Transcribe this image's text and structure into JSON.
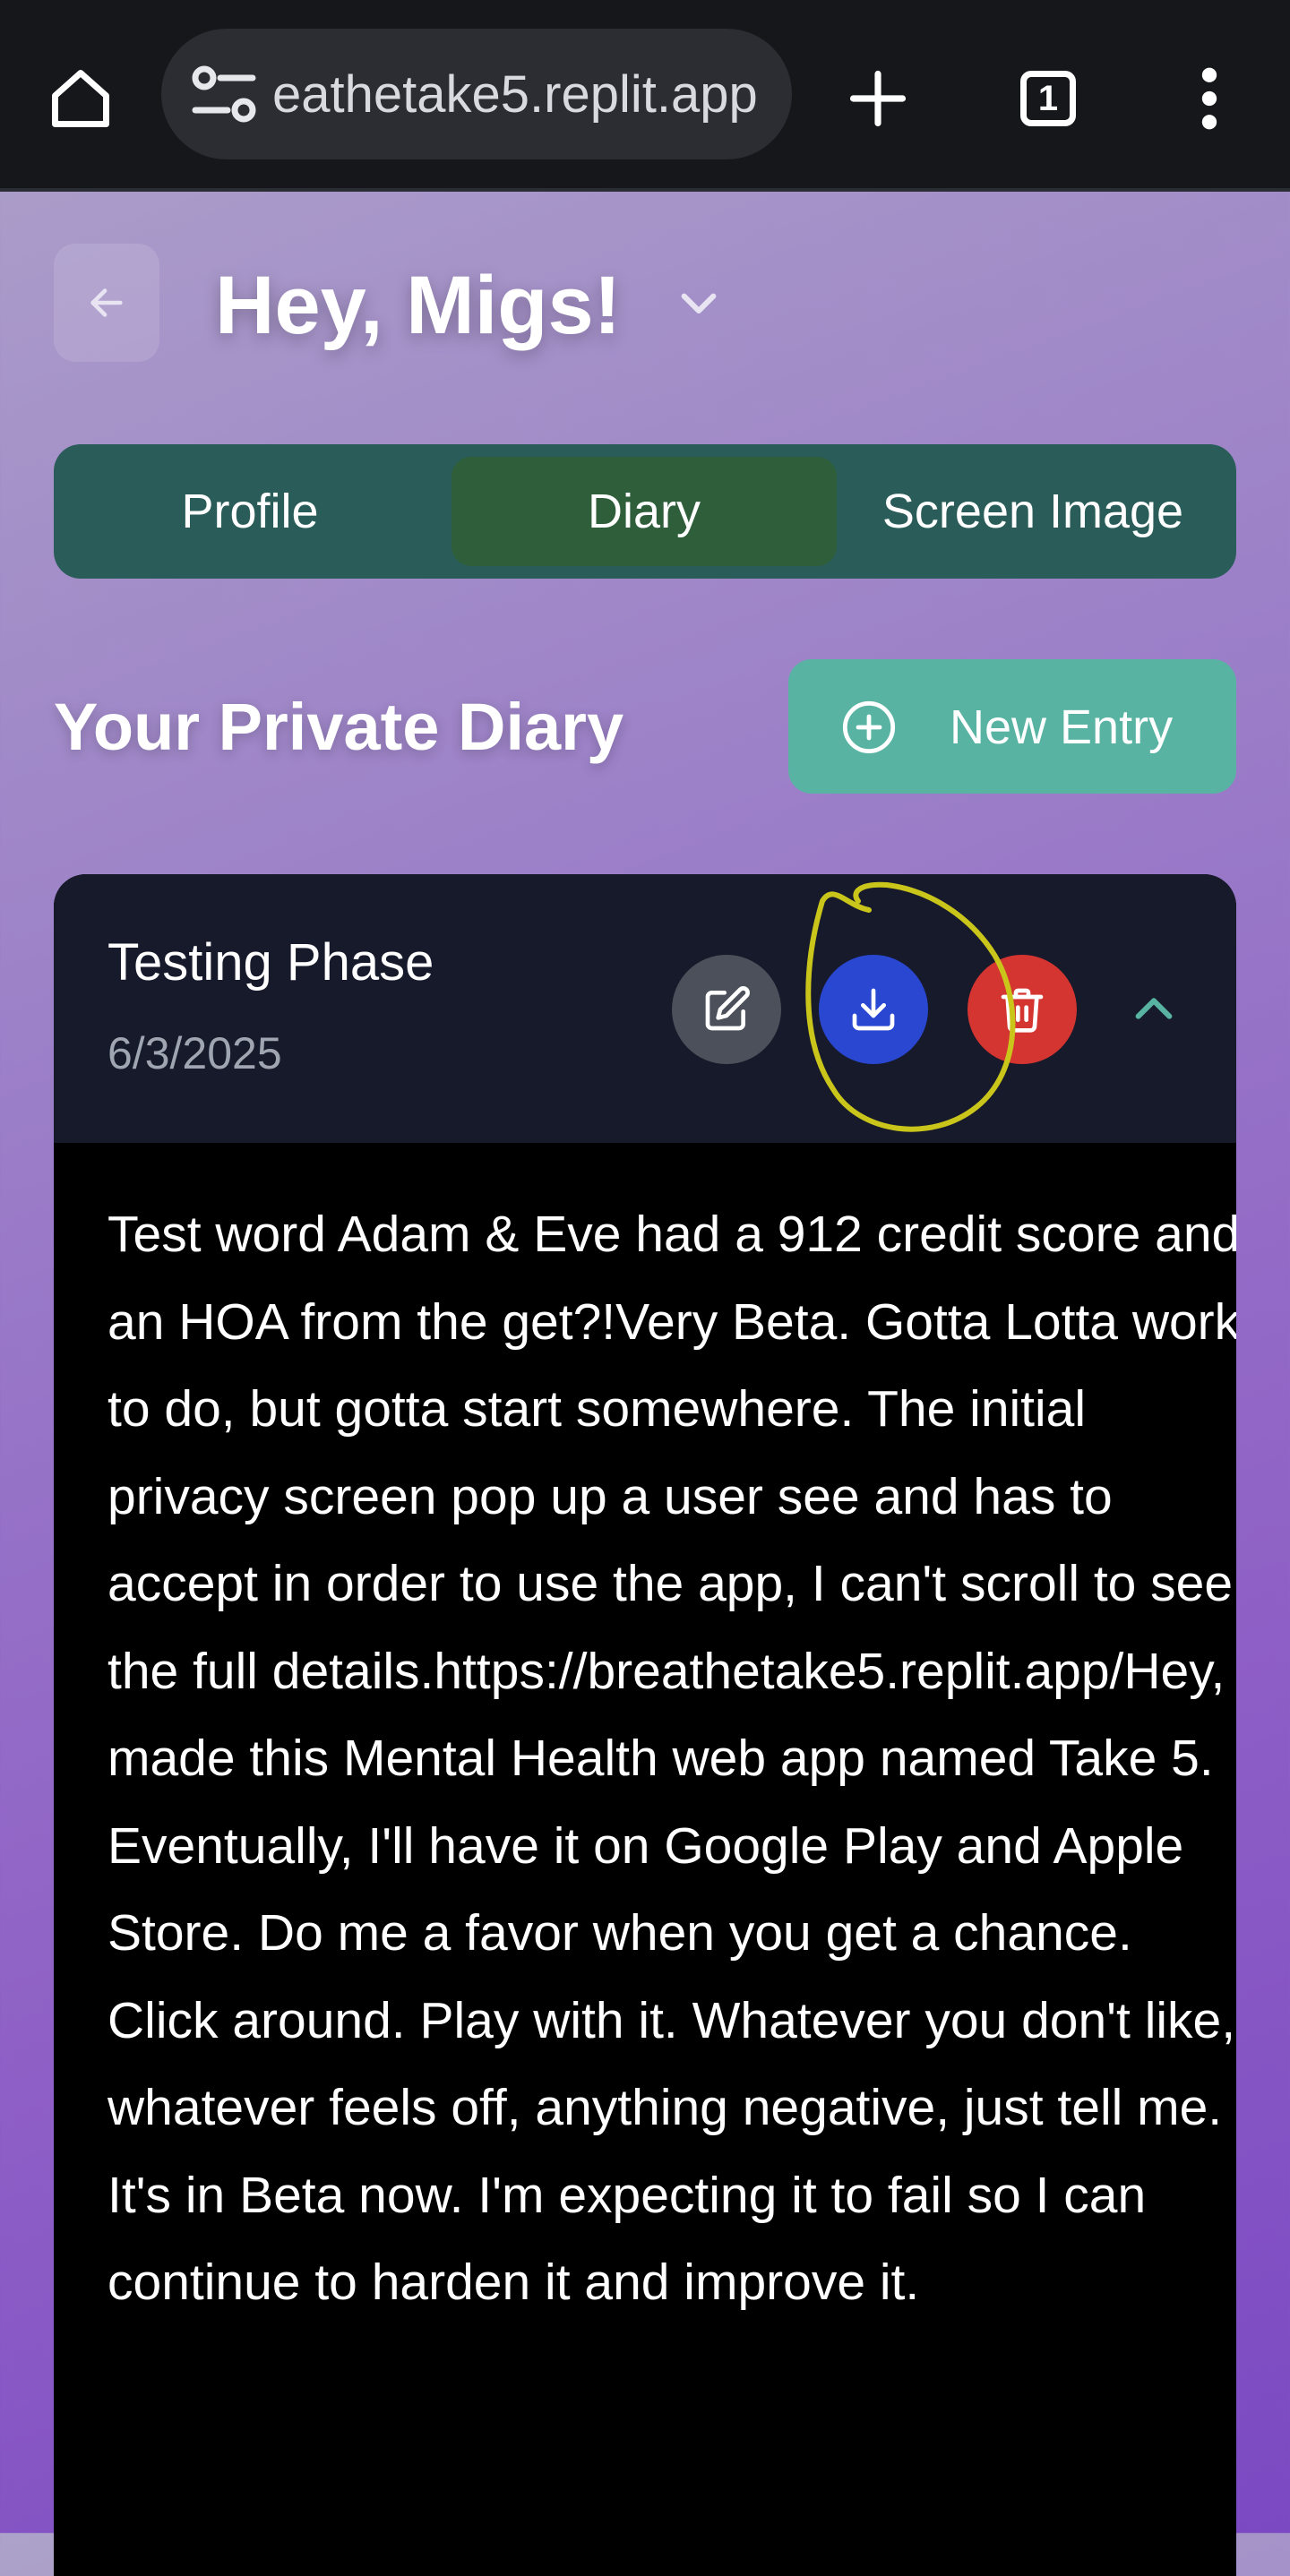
{
  "browser": {
    "url": "eathetake5.replit.app",
    "tab_count": "1"
  },
  "header": {
    "greeting": "Hey, Migs!"
  },
  "tabs": [
    {
      "label": "Profile"
    },
    {
      "label": "Diary"
    },
    {
      "label": "Screen Image"
    }
  ],
  "diary": {
    "title": "Your Private Diary",
    "new_entry_label": "New Entry"
  },
  "entry": {
    "title": "Testing Phase",
    "date": "6/3/2025",
    "body": "Test word Adam & Eve had a 912 credit score and an HOA from the get?!Very Beta. Gotta Lotta work to do, but gotta start somewhere. The initial privacy screen pop up a user see and has to accept in order to use the app, I can't scroll to see the full details.https://breathetake5.replit.app/Hey, I made this Mental Health web app named Take 5. Eventually, I'll have it on Google Play and Apple Store. Do me a favor when you get a chance. Click around. Play with it. Whatever you don't like, whatever feels off, anything negative, just tell me. It's in Beta now. I'm expecting it to fail so I can continue to harden it and improve it."
  },
  "icons": {
    "home": "home-icon",
    "site_settings": "site-settings-icon",
    "new_tab": "plus-icon",
    "tabs": "tabs-icon",
    "menu": "more-vert-icon",
    "back": "arrow-left-icon",
    "dropdown": "chevron-down-icon",
    "new_entry": "plus-circle-icon",
    "edit": "edit-icon",
    "download": "download-icon",
    "delete": "trash-icon",
    "collapse": "chevron-up-icon"
  },
  "colors": {
    "tabbar": "#2a5d59",
    "active_tab": "#2f5e3a",
    "new_entry_button": "#58b3a3",
    "edit_button": "#4b505a",
    "download_button": "#2a47d2",
    "delete_button": "#d43531",
    "annotation": "#c9c51a"
  }
}
